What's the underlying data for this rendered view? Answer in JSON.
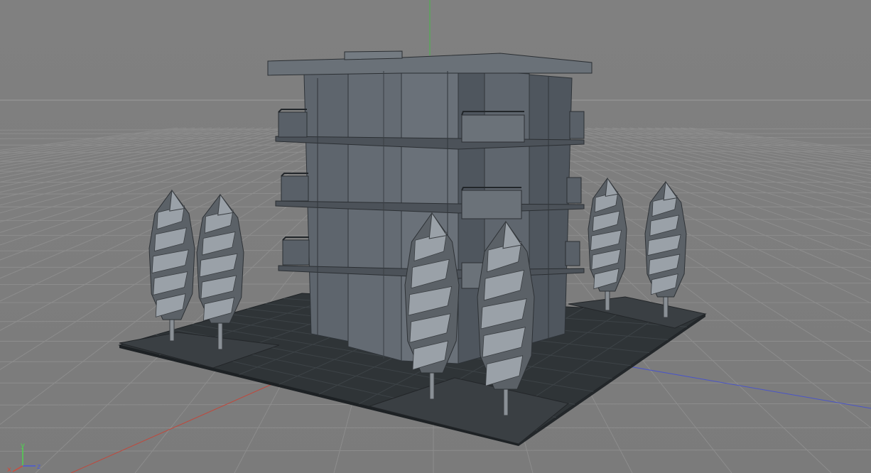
{
  "viewport": {
    "background": "#7c7c7c",
    "grid_color": "#8e8e8e",
    "horizon_color": "#9a9a9a"
  },
  "axes": {
    "x": {
      "label": "x",
      "color": "#d24a3a"
    },
    "y": {
      "label": "y",
      "color": "#4fd24f"
    },
    "z": {
      "label": "z",
      "color": "#4a5ad8"
    }
  },
  "model": {
    "building_color": "#5f6670",
    "building_dark": "#4a5058",
    "ground_tile_color": "#2f3437",
    "tree_light": "#9aa1a8",
    "tree_dark": "#5b6167"
  }
}
